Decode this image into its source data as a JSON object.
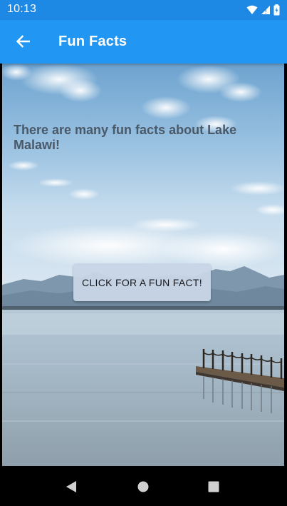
{
  "status_bar": {
    "time": "10:13",
    "icons": [
      "wifi-icon",
      "signal-icon",
      "battery-icon"
    ]
  },
  "app_bar": {
    "title": "Fun Facts",
    "back_icon": "arrow-left-icon",
    "color": "#2196F3"
  },
  "main": {
    "headline": "There are many fun facts about Lake Malawi!",
    "fact_button_label": "CLICK FOR A FUN FACT!"
  },
  "nav_bar": {
    "icons": [
      "back-triangle-icon",
      "home-circle-icon",
      "recents-square-icon"
    ]
  }
}
